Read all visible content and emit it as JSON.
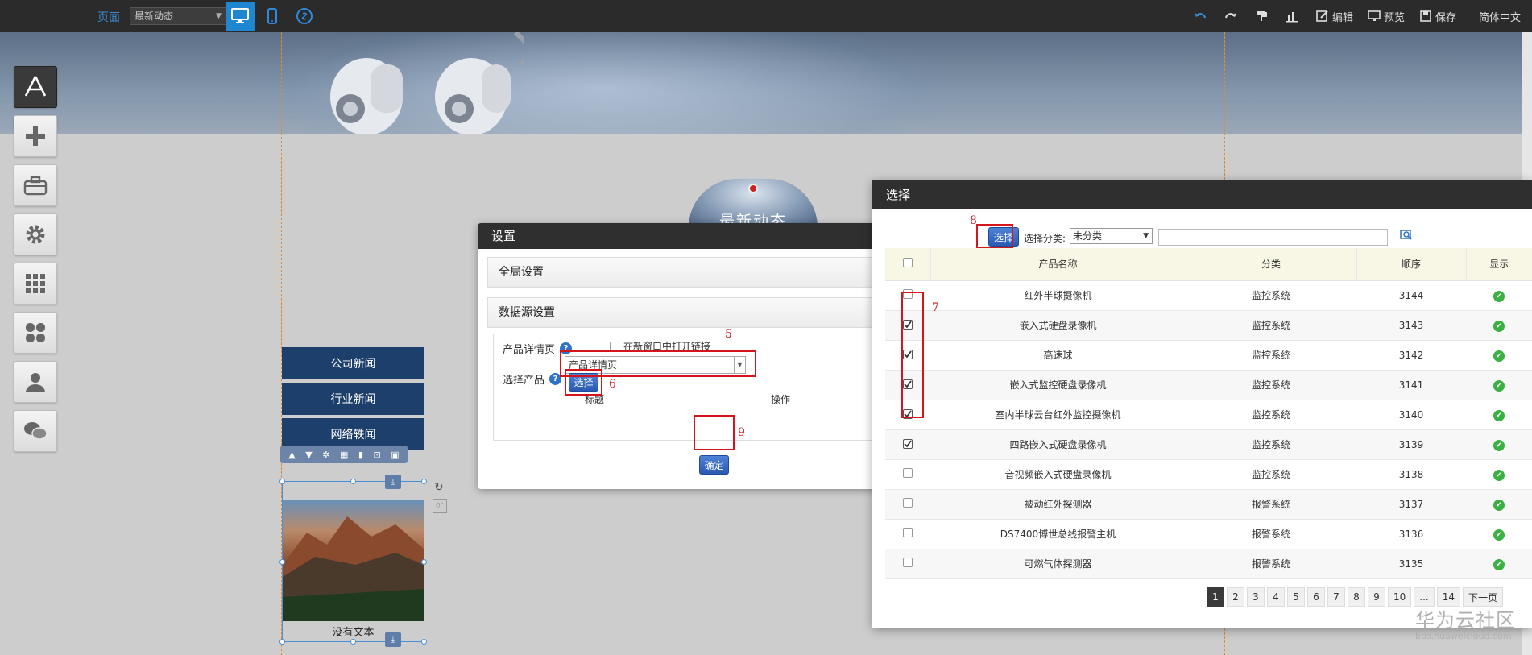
{
  "topbar": {
    "page_label": "页面",
    "page_select": "最新动态",
    "tools": {
      "edit": "编辑",
      "preview": "预览",
      "save": "保存"
    },
    "lang": "简体中文"
  },
  "banner_text": "最新动态",
  "news_menu": [
    "公司新闻",
    "行业新闻",
    "网络轶闻"
  ],
  "image_widget": {
    "caption": "没有文本"
  },
  "settings": {
    "title": "设置",
    "global_panel": "全局设置",
    "datasource_panel": "数据源设置",
    "detail_label": "产品详情页",
    "open_new_window": "在新窗口中打开链接",
    "detail_select": "产品详情页",
    "select_product_label": "选择产品",
    "select_button": "选择",
    "col_title": "标题",
    "col_action": "操作",
    "ok_button": "确定"
  },
  "select_dialog": {
    "title": "选择",
    "select_button": "选择",
    "category_label": "选择分类:",
    "category_value": "未分类",
    "search_value": "",
    "columns": [
      "产品名称",
      "分类",
      "顺序",
      "显示"
    ],
    "rows": [
      {
        "name": "红外半球摄像机",
        "category": "监控系统",
        "order": "3144",
        "checked": false
      },
      {
        "name": "嵌入式硬盘录像机",
        "category": "监控系统",
        "order": "3143",
        "checked": true
      },
      {
        "name": "高速球",
        "category": "监控系统",
        "order": "3142",
        "checked": true
      },
      {
        "name": "嵌入式监控硬盘录像机",
        "category": "监控系统",
        "order": "3141",
        "checked": true
      },
      {
        "name": "室内半球云台红外监控摄像机",
        "category": "监控系统",
        "order": "3140",
        "checked": true
      },
      {
        "name": "四路嵌入式硬盘录像机",
        "category": "监控系统",
        "order": "3139",
        "checked": true
      },
      {
        "name": "音视频嵌入式硬盘录像机",
        "category": "监控系统",
        "order": "3138",
        "checked": false
      },
      {
        "name": "被动红外探测器",
        "category": "报警系统",
        "order": "3137",
        "checked": false
      },
      {
        "name": "DS7400博世总线报警主机",
        "category": "报警系统",
        "order": "3136",
        "checked": false
      },
      {
        "name": "可燃气体探测器",
        "category": "报警系统",
        "order": "3135",
        "checked": false
      }
    ],
    "pager": [
      "1",
      "2",
      "3",
      "4",
      "5",
      "6",
      "7",
      "8",
      "9",
      "10",
      "...",
      "14",
      "下一页"
    ]
  },
  "annotations": [
    "5",
    "6",
    "7",
    "8",
    "9"
  ],
  "watermark": {
    "big": "华为云社区",
    "small": "bbs.huaweicloud.com"
  },
  "colors": {
    "accent": "#1f86d1",
    "menu": "#1d3f6c",
    "highlight": "#d6141b",
    "ok": "#3bb043"
  }
}
